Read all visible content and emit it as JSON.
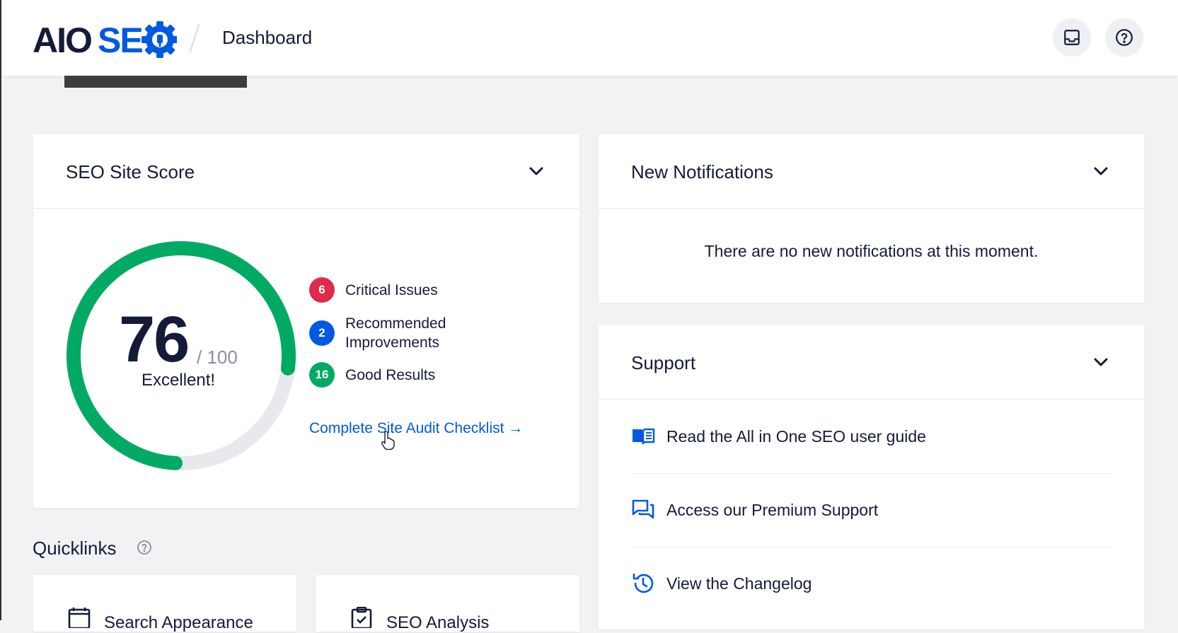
{
  "header": {
    "logo_text": "AIOSEO",
    "page_title": "Dashboard"
  },
  "seo_score": {
    "title": "SEO Site Score",
    "score": "76",
    "max": "/ 100",
    "score_fraction": 0.76,
    "rating": "Excellent!",
    "stats": [
      {
        "count": "6",
        "label": "Critical Issues",
        "color": "#df2a4a"
      },
      {
        "count": "2",
        "label": "Recommended Improvements",
        "color": "#005ae0"
      },
      {
        "count": "16",
        "label": "Good Results",
        "color": "#00aa63"
      }
    ],
    "audit_link": "Complete Site Audit Checklist →"
  },
  "notifications": {
    "title": "New Notifications",
    "empty_message": "There are no new notifications at this moment."
  },
  "support": {
    "title": "Support",
    "items": [
      {
        "label": "Read the All in One SEO user guide",
        "icon": "book-icon"
      },
      {
        "label": "Access our Premium Support",
        "icon": "chat-icon"
      },
      {
        "label": "View the Changelog",
        "icon": "history-icon"
      }
    ]
  },
  "quicklinks": {
    "title": "Quicklinks",
    "items": [
      {
        "label": "Search Appearance",
        "icon": "search-appearance-icon"
      },
      {
        "label": "SEO Analysis",
        "icon": "seo-analysis-icon"
      }
    ]
  },
  "colors": {
    "accent": "#005ae0",
    "good": "#00aa63",
    "critical": "#df2a4a",
    "text": "#141b38",
    "background": "#f1f2f4"
  }
}
